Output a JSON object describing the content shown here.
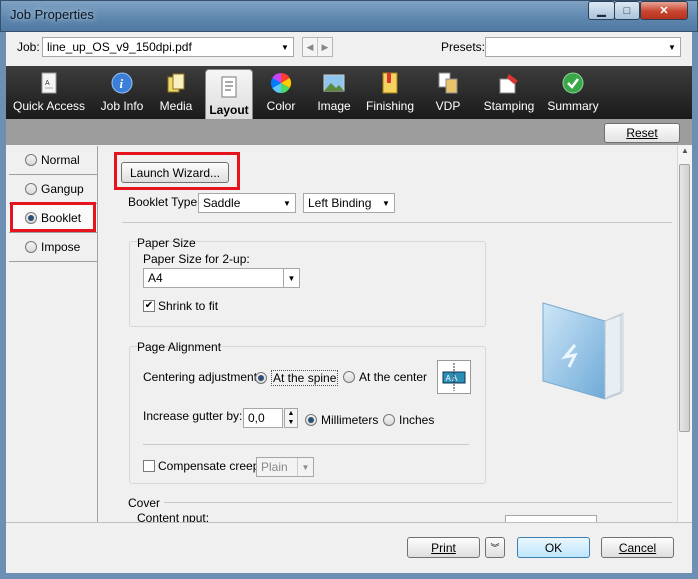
{
  "window": {
    "title": "Job Properties"
  },
  "job": {
    "label": "Job:",
    "value": "line_up_OS_v9_150dpi.pdf",
    "presets_label": "Presets:",
    "presets_value": ""
  },
  "tabs": [
    {
      "label": "Quick Access",
      "icon": "quick-access-icon"
    },
    {
      "label": "Job Info",
      "icon": "info-icon"
    },
    {
      "label": "Media",
      "icon": "media-icon"
    },
    {
      "label": "Layout",
      "icon": "layout-icon",
      "active": true
    },
    {
      "label": "Color",
      "icon": "color-wheel-icon"
    },
    {
      "label": "Image",
      "icon": "image-icon"
    },
    {
      "label": "Finishing",
      "icon": "finishing-icon"
    },
    {
      "label": "VDP",
      "icon": "vdp-icon"
    },
    {
      "label": "Stamping",
      "icon": "stamp-icon"
    },
    {
      "label": "Summary",
      "icon": "checkmark-icon"
    }
  ],
  "reset_label": "Reset",
  "leftnav": [
    {
      "label": "Normal",
      "selected": false
    },
    {
      "label": "Gangup",
      "selected": false
    },
    {
      "label": "Booklet",
      "selected": true
    },
    {
      "label": "Impose",
      "selected": false
    }
  ],
  "main": {
    "launch_wizard": "Launch Wizard...",
    "booklet_type_label": "Booklet Type:",
    "booklet_type_value": "Saddle",
    "binding_value": "Left Binding",
    "paper_size": {
      "title": "Paper Size",
      "label": "Paper Size for 2-up:",
      "value": "A4",
      "shrink_label": "Shrink to fit",
      "shrink_checked": true
    },
    "page_alignment": {
      "title": "Page Alignment",
      "centering_label": "Centering adjustment:",
      "at_spine": "At the spine",
      "at_center": "At the center",
      "centering_selected": "spine",
      "gutter_label": "Increase gutter by:",
      "gutter_value": "0,0",
      "millimeters": "Millimeters",
      "inches": "Inches",
      "unit_selected": "mm",
      "compensate_label": "Compensate creep",
      "compensate_checked": false,
      "creep_value": "Plain",
      "diagram_text": "A A"
    },
    "cover": {
      "title": "Cover",
      "content_input_label": "Content nput:"
    }
  },
  "footer": {
    "print": "Print",
    "ok": "OK",
    "cancel": "Cancel"
  },
  "colors": {
    "highlight_red": "#e5141c",
    "ribbon_dark": "#1a1a1a",
    "window_blue": "#6c8fb3"
  }
}
